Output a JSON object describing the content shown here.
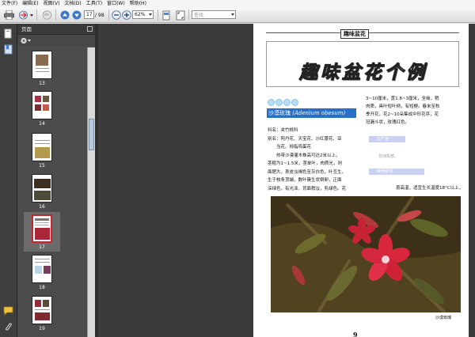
{
  "menubar": {
    "items": [
      "文件(F)",
      "编辑(E)",
      "视图(V)",
      "文档(D)",
      "工具(T)",
      "窗口(W)",
      "帮助(H)"
    ]
  },
  "toolbar": {
    "current_page": "17",
    "page_count": "/ 98",
    "zoom": "62%",
    "search_placeholder": "查找",
    "icons": [
      "print-icon",
      "email-icon",
      "hand-tool-icon",
      "prev-page-icon",
      "next-page-icon",
      "zoom-out-icon",
      "zoom-in-icon",
      "fit-page-icon",
      "full-screen-icon"
    ]
  },
  "panel": {
    "title": "页面",
    "thumbnails": [
      {
        "label": "13"
      },
      {
        "label": "14"
      },
      {
        "label": "15"
      },
      {
        "label": "16"
      },
      {
        "label": "17",
        "selected": true
      },
      {
        "label": "18"
      },
      {
        "label": "19"
      }
    ]
  },
  "page": {
    "header": "趣味盆花",
    "title": "趣味盆花个例",
    "heading_cn": "沙漠玫瑰",
    "heading_latin": "(Adenium obesum)",
    "left_lines": [
      "科名：夹竹桃科",
      "别名：阿丹花、天宝花、沙红蕾花、亚",
      "　　当花、拇指鸡蛋花",
      "　　热带沙漠灌木株高可达2米以上，",
      "茎粗为1~1.5米，茎单叶，肉质光，则",
      "面肥大，表皮淡褐色至灰白色，叶互生，",
      "生于枝条顶端，数叶簇生状倒卵，正面",
      "深绿色，有光泽，背面稍淡，乳绿色。花"
    ],
    "right_lines": [
      "3~10厘米，宽1.8~3厘米，全缘，稍",
      "肉质，具叶短叶柄，有短梗。春末至秋",
      "季开花，花2~10朵集成伞形花序，花",
      "冠漏斗状，玫瑰红色。"
    ],
    "tag1": "生产地",
    "tag1_text": "非洲东部。",
    "tag2": "种养要领",
    "right_bottom": "喜高温，适宜生长温度18°C以上，",
    "caption": "沙漠玫瑰",
    "page_number": "9"
  },
  "colors": {
    "heading_bg": "#2a6fc2",
    "selection": "#c7262f",
    "dark_panel": "#4c4c4c"
  }
}
